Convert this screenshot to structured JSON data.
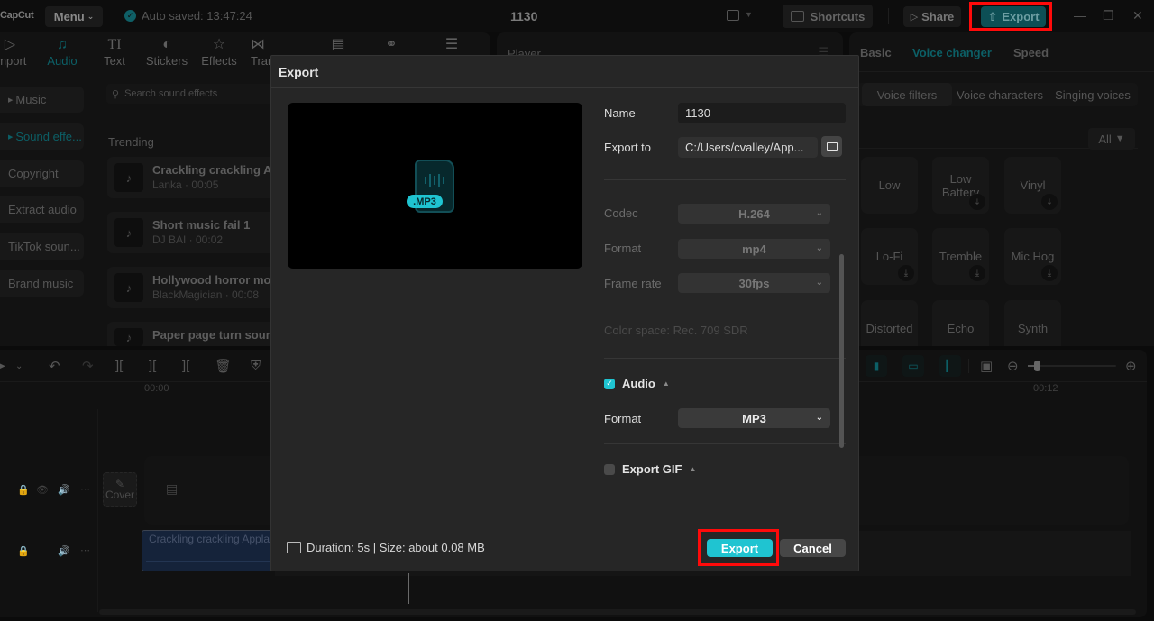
{
  "app": {
    "logo": "CapCut",
    "menu_label": "Menu",
    "autosave": "Auto saved: 13:47:24",
    "project_title": "1130",
    "shortcuts_label": "Shortcuts",
    "share_label": "Share",
    "export_label": "Export"
  },
  "toolbar": {
    "tools": [
      {
        "label": "Import",
        "icon": "import-icon"
      },
      {
        "label": "Audio",
        "icon": "music-note-icon",
        "active": true
      },
      {
        "label": "Text",
        "icon": "text-icon"
      },
      {
        "label": "Stickers",
        "icon": "sticker-icon"
      },
      {
        "label": "Effects",
        "icon": "effects-star-icon"
      },
      {
        "label": "Transitions",
        "icon": "transition-icon"
      },
      {
        "label": "Captions",
        "icon": "captions-icon"
      },
      {
        "label": "Filters",
        "icon": "filters-icon"
      },
      {
        "label": "Adjustment",
        "icon": "adjustment-icon"
      }
    ]
  },
  "audio_sidebar": {
    "items": [
      {
        "label": "Music"
      },
      {
        "label": "Sound effe...",
        "active": true
      },
      {
        "label": "Copyright"
      },
      {
        "label": "Extract audio"
      },
      {
        "label": "TikTok soun..."
      },
      {
        "label": "Brand music"
      }
    ]
  },
  "sound_effects": {
    "search_placeholder": "Search sound effects",
    "section_title": "Trending",
    "items": [
      {
        "title": "Crackling crackling Ap",
        "sub": "Lanka · 00:05"
      },
      {
        "title": "Short music fail 1",
        "sub": "DJ BAI · 00:02"
      },
      {
        "title": "Hollywood horror mo",
        "sub": "BlackMagician · 00:08"
      },
      {
        "title": "Paper page turn soun",
        "sub": ""
      }
    ]
  },
  "player": {
    "title": "Player"
  },
  "right_panel": {
    "tabs": [
      {
        "label": "Basic"
      },
      {
        "label": "Voice changer",
        "active": true
      },
      {
        "label": "Speed"
      }
    ],
    "subtabs": [
      {
        "label": "Voice filters",
        "active": true
      },
      {
        "label": "Voice characters"
      },
      {
        "label": "Singing voices"
      }
    ],
    "filter_label": "All",
    "voice_filters": [
      {
        "label": "Low",
        "download": false
      },
      {
        "label": "Low Battery",
        "download": true
      },
      {
        "label": "Vinyl",
        "download": true
      },
      {
        "label": "Lo-Fi",
        "download": true
      },
      {
        "label": "Tremble",
        "download": true
      },
      {
        "label": "Mic Hog",
        "download": true
      },
      {
        "label": "Distorted",
        "download": true
      },
      {
        "label": "Echo",
        "download": true
      },
      {
        "label": "Synth",
        "download": true
      }
    ]
  },
  "timeline": {
    "ruler_start": "00:00",
    "ruler_mark": "00:12",
    "cover_label": "Cover",
    "audio_clip_label": "Crackling crackling Appla",
    "zoom_level": 0.1
  },
  "export_dialog": {
    "title": "Export",
    "file_badge": ".MP3",
    "name_label": "Name",
    "name_value": "1130",
    "export_to_label": "Export to",
    "export_to_value": "C:/Users/cvalley/App...",
    "codec_label": "Codec",
    "codec_value": "H.264",
    "format_label": "Format",
    "format_value": "mp4",
    "framerate_label": "Frame rate",
    "framerate_value": "30fps",
    "color_space": "Color space: Rec. 709 SDR",
    "audio_section": "Audio",
    "audio_checked": true,
    "audio_format_label": "Format",
    "audio_format_value": "MP3",
    "gif_section": "Export GIF",
    "gif_checked": false,
    "footer_info": "Duration: 5s | Size: about 0.08 MB",
    "export_button": "Export",
    "cancel_button": "Cancel"
  },
  "colors": {
    "accent": "#1fc4d1",
    "highlight_box": "#ff0a0a",
    "dialog_bg": "#262626"
  }
}
